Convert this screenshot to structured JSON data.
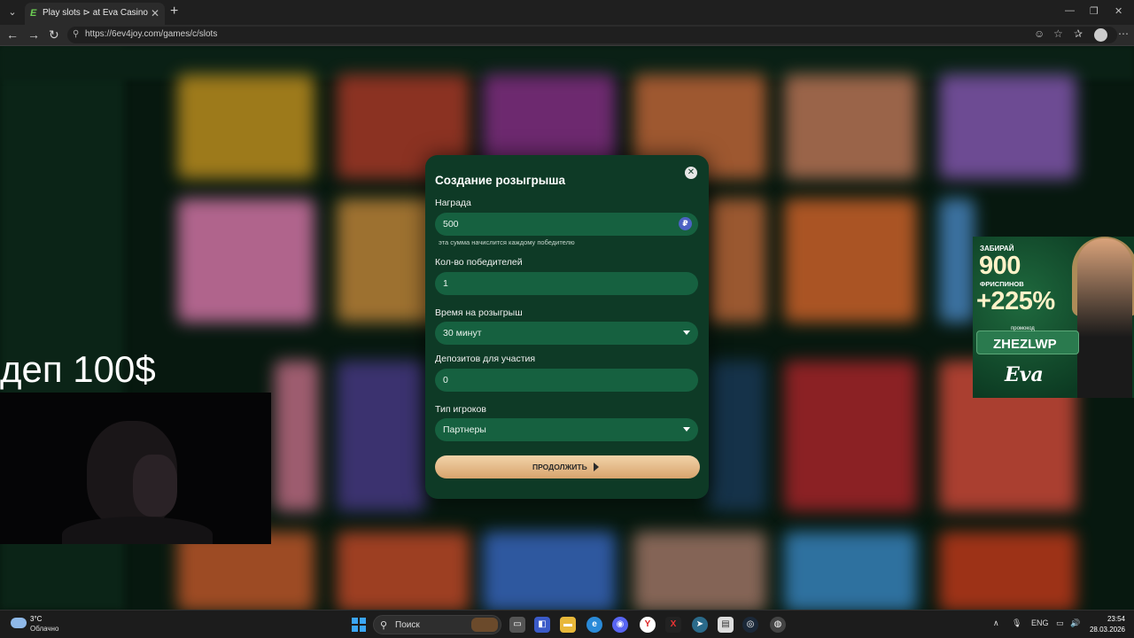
{
  "browser": {
    "tab_title": "Play slots ⊳ at Eva Casino",
    "tab_favicon": "E",
    "url": "https://6ev4joy.com/games/c/slots"
  },
  "modal": {
    "title": "Создание розыгрыша",
    "reward_label": "Награда",
    "reward_value": "500",
    "reward_currency": "₽",
    "reward_hint": "эта сумма начислится каждому победителю",
    "winners_label": "Кол-во победителей",
    "winners_value": "1",
    "time_label": "Время на розыгрыш",
    "time_value": "30 минут",
    "deposits_label": "Депозитов для участия",
    "deposits_value": "0",
    "players_label": "Тип игроков",
    "players_value": "Партнеры",
    "continue_label": "ПРОДОЛЖИТЬ"
  },
  "overlay": {
    "stream_text": "деп 100$"
  },
  "promo": {
    "line1": "ЗАБИРАЙ",
    "line2": "900",
    "line3": "ФРИСПИНОВ",
    "line4": "+225%",
    "code_label": "промокод",
    "code": "ZHEZLWP",
    "brand": "Eva"
  },
  "taskbar": {
    "weather_temp": "3°C",
    "weather_desc": "Облачно",
    "search_label": "Поиск",
    "lang": "ENG",
    "time": "23:54",
    "date": "28.03.2026"
  },
  "colors": {
    "modal_bg": "#0e3a26",
    "field_bg": "#166140",
    "cta_gradient": "#d7a46d",
    "page_bg": "#07180f"
  }
}
